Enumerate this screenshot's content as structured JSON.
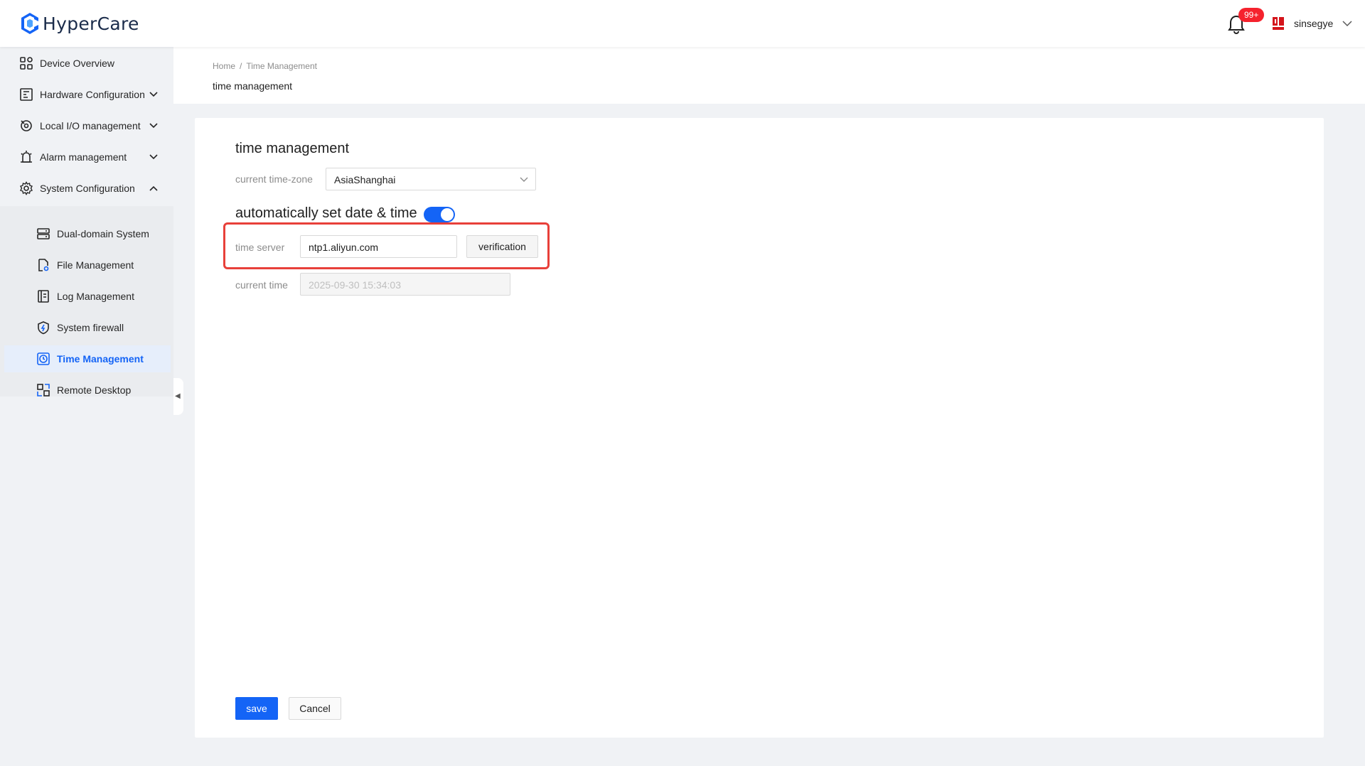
{
  "app": {
    "name": "HyperCare"
  },
  "header": {
    "notification_badge": "99+",
    "username": "sinsegye"
  },
  "sidebar": {
    "items": [
      {
        "label": "Device Overview",
        "icon": "grid-icon"
      },
      {
        "label": "Hardware Configuration",
        "icon": "hardware-icon",
        "expanded": false
      },
      {
        "label": "Local I/O management",
        "icon": "io-icon",
        "expanded": false
      },
      {
        "label": "Alarm management",
        "icon": "alarm-icon",
        "expanded": false
      },
      {
        "label": "System Configuration",
        "icon": "gear-icon",
        "expanded": true
      }
    ],
    "subitems": [
      {
        "label": "Dual-domain System",
        "icon": "server-icon"
      },
      {
        "label": "File Management",
        "icon": "file-gear-icon"
      },
      {
        "label": "Log Management",
        "icon": "log-icon"
      },
      {
        "label": "System firewall",
        "icon": "shield-icon"
      },
      {
        "label": "Time Management",
        "icon": "clock-icon",
        "active": true
      },
      {
        "label": "Remote Desktop",
        "icon": "remote-desktop-icon"
      }
    ]
  },
  "breadcrumb": {
    "home": "Home",
    "separator": "/",
    "current": "Time Management"
  },
  "page": {
    "title": "time management"
  },
  "form": {
    "section_title": "time management",
    "timezone_label": "current time-zone",
    "timezone_value": "AsiaShanghai",
    "auto_title": "automatically set date & time",
    "auto_enabled": true,
    "server_label": "time server",
    "server_value": "ntp1.aliyun.com",
    "verify_label": "verification",
    "current_time_label": "current time",
    "current_time_value": "2025-09-30 15:34:03"
  },
  "actions": {
    "save": "save",
    "cancel": "Cancel"
  },
  "colors": {
    "accent": "#1464f6",
    "highlight": "#e8403a",
    "badge": "#f5222d"
  }
}
